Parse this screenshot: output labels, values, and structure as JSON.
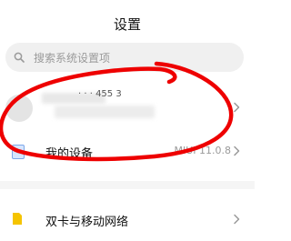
{
  "header": {
    "title": "设置"
  },
  "search": {
    "placeholder": "搜索系统设置项"
  },
  "account": {
    "text_fragment": "· · ·  455 3"
  },
  "device": {
    "label": "我的设备",
    "value": "MIUI 11.0.8"
  },
  "network": {
    "label": "双卡与移动网络"
  },
  "colors": {
    "annotation": "#ee0000",
    "sim_icon": "#f5c400",
    "device_icon": "#7da7e8"
  },
  "icons": {
    "search": "search-icon",
    "chevron": "chevron-right-icon",
    "device": "phone-icon",
    "sim": "sim-card-icon"
  }
}
